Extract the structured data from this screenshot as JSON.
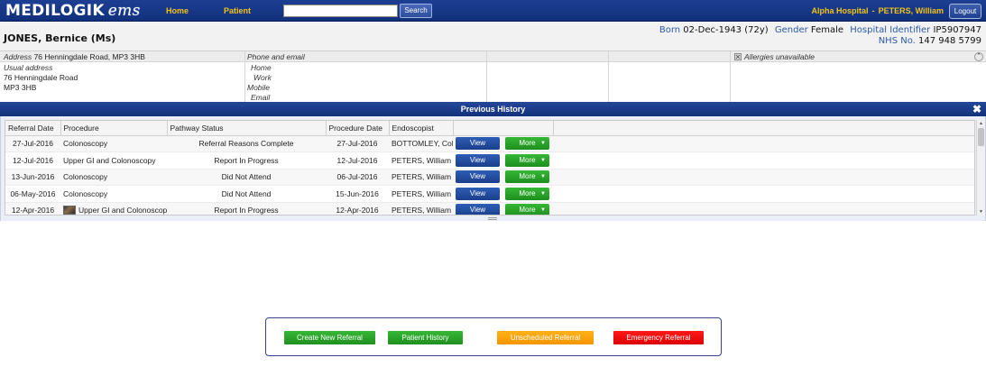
{
  "header": {
    "logo_main": "MEDILOGIK",
    "logo_sub": "ems",
    "nav": [
      {
        "label": "Home"
      },
      {
        "label": "Patient"
      }
    ],
    "search_value": "",
    "search_button": "Search",
    "hospital": "Alpha Hospital",
    "separator": "-",
    "user": "PETERS, William",
    "logout_label": "Logout"
  },
  "patient": {
    "name": "JONES, Bernice (Ms)",
    "born_label": "Born",
    "born_value": "02-Dec-1943 (72y)",
    "gender_label": "Gender",
    "gender_value": "Female",
    "hospital_id_label": "Hospital Identifier",
    "hospital_id_value": "IP5907947",
    "nhs_label": "NHS No.",
    "nhs_value": "147 948 5799"
  },
  "address": {
    "header_label": "Address",
    "header_value": "76 Henningdale Road, MP3 3HB",
    "usual_label": "Usual address",
    "line1": "76 Henningdale Road",
    "line2": "MP3 3HB",
    "phone_header": "Phone and email",
    "phone_labels": [
      "Home",
      "Work",
      "Mobile",
      "Email"
    ],
    "allergies": "Allergies unavailable"
  },
  "history": {
    "title": "Previous History",
    "columns": [
      "Referral Date",
      "Procedure",
      "Pathway Status",
      "Procedure Date",
      "Endoscopist",
      ""
    ],
    "view_label": "View",
    "more_label": "More",
    "rows": [
      {
        "referral_date": "27-Jul-2016",
        "procedure": "Colonoscopy",
        "status": "Referral Reasons Complete",
        "procedure_date": "27-Jul-2016",
        "endoscopist": "BOTTOMLEY, Colin",
        "has_image": false
      },
      {
        "referral_date": "12-Jul-2016",
        "procedure": "Upper GI and Colonoscopy",
        "status": "Report In Progress",
        "procedure_date": "12-Jul-2016",
        "endoscopist": "PETERS, William",
        "has_image": false
      },
      {
        "referral_date": "13-Jun-2016",
        "procedure": "Colonoscopy",
        "status": "Did Not Attend",
        "procedure_date": "06-Jul-2016",
        "endoscopist": "PETERS, William",
        "has_image": false
      },
      {
        "referral_date": "06-May-2016",
        "procedure": "Colonoscopy",
        "status": "Did Not Attend",
        "procedure_date": "15-Jun-2016",
        "endoscopist": "PETERS, William",
        "has_image": false
      },
      {
        "referral_date": "12-Apr-2016",
        "procedure": "Upper GI and Colonoscopy",
        "status": "Report In Progress",
        "procedure_date": "12-Apr-2016",
        "endoscopist": "PETERS, William",
        "has_image": true
      }
    ]
  },
  "actions": [
    {
      "label": "Create New Referral",
      "color": "#2aa82a"
    },
    {
      "label": "Patient History",
      "color": "#2aa82a"
    },
    {
      "label": "Unscheduled Referral",
      "color": "#f7a50b"
    },
    {
      "label": "Emergency Referral",
      "color": "#ee0000"
    }
  ],
  "colors": {
    "brand_blue": "#1a3a8a",
    "nav_gold": "#f3c316",
    "label_blue": "#2b5aa5"
  }
}
